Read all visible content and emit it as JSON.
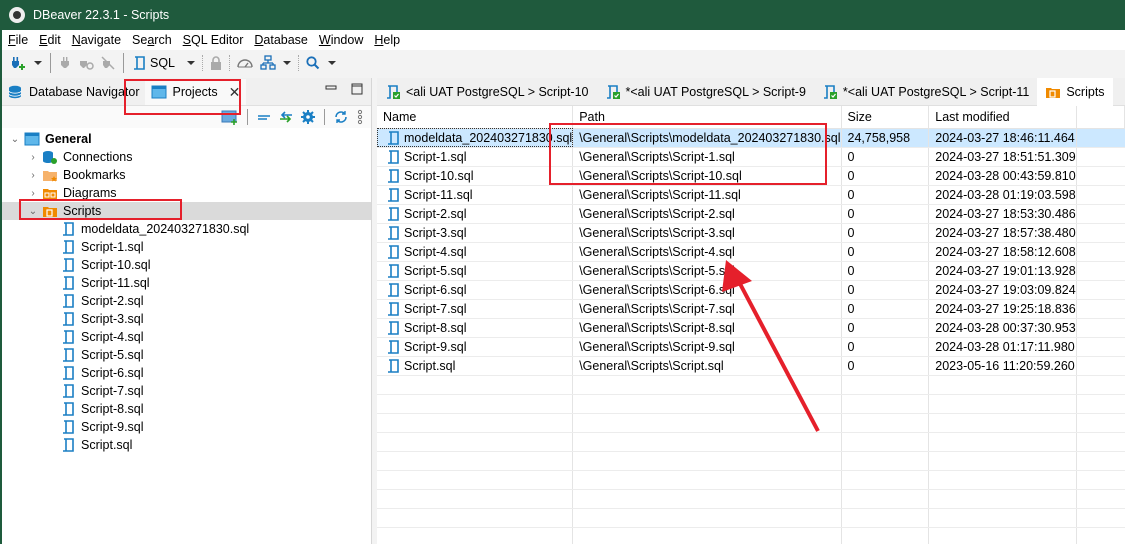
{
  "window": {
    "title": "DBeaver 22.3.1 - Scripts"
  },
  "menu": [
    {
      "label": "File",
      "mnemonic": "F",
      "rest": "ile"
    },
    {
      "label": "Edit",
      "mnemonic": "E",
      "rest": "dit"
    },
    {
      "label": "Navigate",
      "mnemonic": "N",
      "rest": "avigate"
    },
    {
      "label": "Search",
      "pre": "Se",
      "mnemonic": "a",
      "rest": "rch"
    },
    {
      "label": "SQL Editor",
      "mnemonic": "S",
      "rest": "QL Editor"
    },
    {
      "label": "Database",
      "mnemonic": "D",
      "rest": "atabase"
    },
    {
      "label": "Window",
      "mnemonic": "W",
      "rest": "indow"
    },
    {
      "label": "Help",
      "mnemonic": "H",
      "rest": "elp"
    }
  ],
  "toolbar": {
    "sql_label": "SQL"
  },
  "left_panel": {
    "tabs": [
      {
        "label": "Database Navigator",
        "active": false
      },
      {
        "label": "Projects",
        "active": true
      }
    ],
    "close_glyph": "✕",
    "tree": {
      "root": "General",
      "folders": [
        "Connections",
        "Bookmarks",
        "Diagrams",
        "Scripts"
      ],
      "scripts": [
        "modeldata_202403271830.sql",
        "Script-1.sql",
        "Script-10.sql",
        "Script-11.sql",
        "Script-2.sql",
        "Script-3.sql",
        "Script-4.sql",
        "Script-5.sql",
        "Script-6.sql",
        "Script-7.sql",
        "Script-8.sql",
        "Script-9.sql",
        "Script.sql"
      ]
    }
  },
  "editor_tabs": [
    {
      "label": "<ali  UAT PostgreSQL > Script-10",
      "active": false
    },
    {
      "label": "*<ali  UAT PostgreSQL > Script-9",
      "active": false
    },
    {
      "label": "*<ali  UAT PostgreSQL > Script-11",
      "active": false
    },
    {
      "label": "Scripts",
      "active": true
    }
  ],
  "table": {
    "columns": [
      "Name",
      "Path",
      "Size",
      "Last modified"
    ],
    "rows": [
      {
        "name": "modeldata_202403271830.sql",
        "path": "\\General\\Scripts\\modeldata_202403271830.sql",
        "size": "24,758,958",
        "modified": "2024-03-27 18:46:11.464",
        "selected": true
      },
      {
        "name": "Script-1.sql",
        "path": "\\General\\Scripts\\Script-1.sql",
        "size": "0",
        "modified": "2024-03-27 18:51:51.309"
      },
      {
        "name": "Script-10.sql",
        "path": "\\General\\Scripts\\Script-10.sql",
        "size": "0",
        "modified": "2024-03-28 00:43:59.810"
      },
      {
        "name": "Script-11.sql",
        "path": "\\General\\Scripts\\Script-11.sql",
        "size": "0",
        "modified": "2024-03-28 01:19:03.598"
      },
      {
        "name": "Script-2.sql",
        "path": "\\General\\Scripts\\Script-2.sql",
        "size": "0",
        "modified": "2024-03-27 18:53:30.486"
      },
      {
        "name": "Script-3.sql",
        "path": "\\General\\Scripts\\Script-3.sql",
        "size": "0",
        "modified": "2024-03-27 18:57:38.480"
      },
      {
        "name": "Script-4.sql",
        "path": "\\General\\Scripts\\Script-4.sql",
        "size": "0",
        "modified": "2024-03-27 18:58:12.608"
      },
      {
        "name": "Script-5.sql",
        "path": "\\General\\Scripts\\Script-5.sql",
        "size": "0",
        "modified": "2024-03-27 19:01:13.928"
      },
      {
        "name": "Script-6.sql",
        "path": "\\General\\Scripts\\Script-6.sql",
        "size": "0",
        "modified": "2024-03-27 19:03:09.824"
      },
      {
        "name": "Script-7.sql",
        "path": "\\General\\Scripts\\Script-7.sql",
        "size": "0",
        "modified": "2024-03-27 19:25:18.836"
      },
      {
        "name": "Script-8.sql",
        "path": "\\General\\Scripts\\Script-8.sql",
        "size": "0",
        "modified": "2024-03-28 00:37:30.953"
      },
      {
        "name": "Script-9.sql",
        "path": "\\General\\Scripts\\Script-9.sql",
        "size": "0",
        "modified": "2024-03-28 01:17:11.980"
      },
      {
        "name": "Script.sql",
        "path": "\\General\\Scripts\\Script.sql",
        "size": "0",
        "modified": "2023-05-16 11:20:59.260"
      }
    ],
    "empty_rows": 9
  },
  "colors": {
    "titlebar": "#1f5a3d",
    "selection": "#cce8ff",
    "annotation": "#e5202b",
    "script_icon": "#1a7fc4",
    "folder_orange": "#f08a00"
  }
}
